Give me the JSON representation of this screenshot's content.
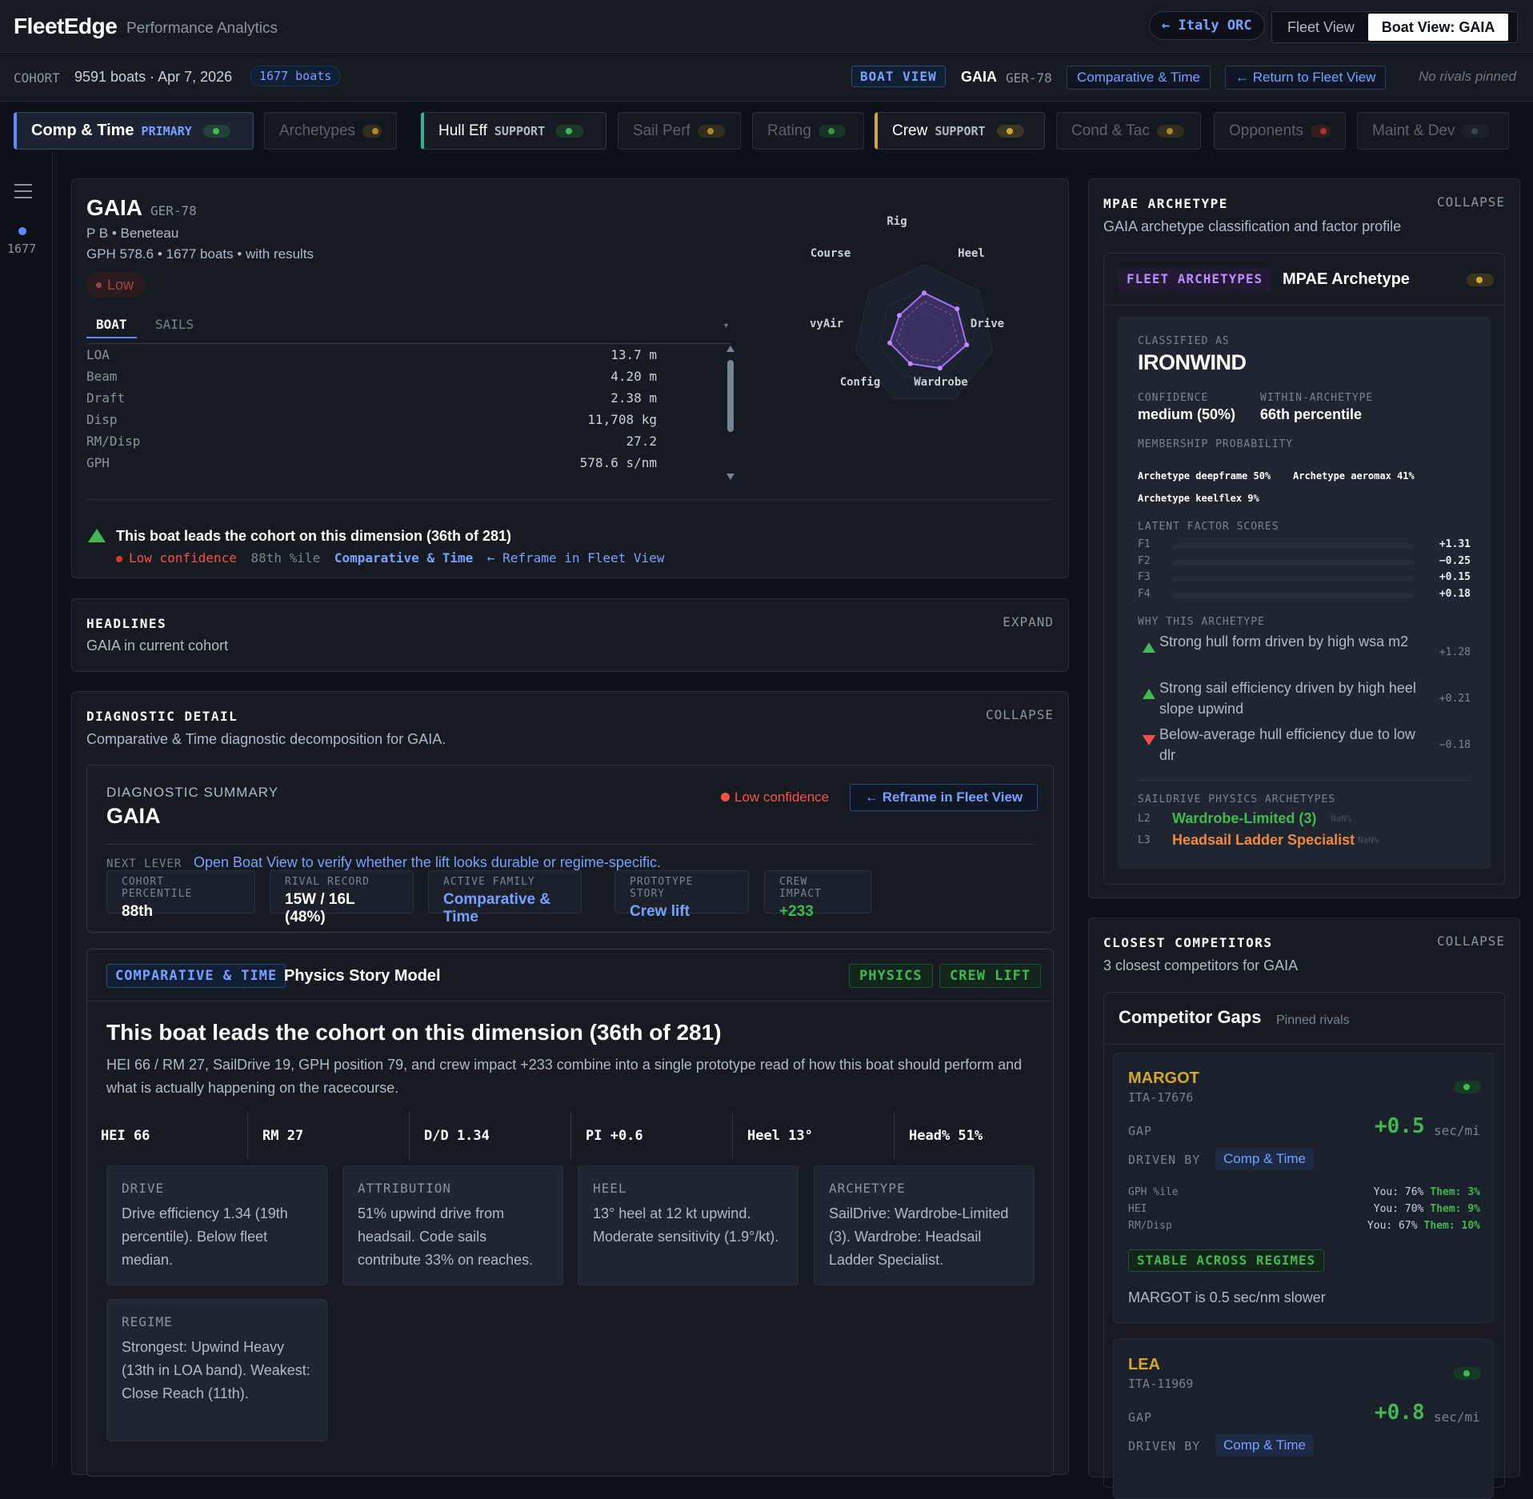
{
  "app": {
    "brand": "FleetEdge",
    "subtitle": "Performance Analytics",
    "orc_pill": "← Italy ORC",
    "views": [
      "Fleet View",
      "Boat View: GAIA"
    ]
  },
  "cohort": {
    "label": "COHORT",
    "summary": "9591 boats · Apr 7, 2026",
    "count_badge": "1677 boats",
    "boat_view_badge": "BOAT VIEW",
    "boat_name": "GAIA",
    "sail_no": "GER-78",
    "comparative_btn": "Comparative & Time",
    "return_btn": "← Return to Fleet View",
    "rivals": "No rivals pinned"
  },
  "tabs": [
    {
      "label": "Comp & Time",
      "kind": "PRIMARY",
      "accent": "#5b8cff",
      "dot": "#3fb950"
    },
    {
      "label": "Archetypes",
      "kind": "",
      "accent": "",
      "dot": "#d4a72c"
    },
    {
      "label": "Hull Eff",
      "kind": "SUPPORT",
      "accent": "#2fb394",
      "dot": "#3fb950"
    },
    {
      "label": "Sail Perf",
      "kind": "",
      "accent": "",
      "dot": "#d4a72c"
    },
    {
      "label": "Rating",
      "kind": "",
      "accent": "",
      "dot": "#3fb950"
    },
    {
      "label": "Crew",
      "kind": "SUPPORT",
      "accent": "#d4a72c",
      "dot": "#d4a72c"
    },
    {
      "label": "Cond & Tac",
      "kind": "",
      "accent": "",
      "dot": "#d4a72c"
    },
    {
      "label": "Opponents",
      "kind": "",
      "accent": "",
      "dot": "#da3633"
    },
    {
      "label": "Maint & Dev",
      "kind": "",
      "accent": "",
      "dot": "#484f58"
    }
  ],
  "rail": {
    "count": "1677"
  },
  "boat": {
    "name": "GAIA",
    "sail_no": "GER-78",
    "model": "P B • Beneteau",
    "gph_line": "GPH 578.6 • 1677 boats • with results",
    "conf_badge": "Low",
    "tabs": [
      "BOAT",
      "SAILS"
    ],
    "specs": [
      {
        "k": "LOA",
        "v": "13.7 m"
      },
      {
        "k": "Beam",
        "v": "4.20 m"
      },
      {
        "k": "Draft",
        "v": "2.38 m"
      },
      {
        "k": "Disp",
        "v": "11,708 kg"
      },
      {
        "k": "RM/Disp",
        "v": "27.2"
      },
      {
        "k": "GPH",
        "v": "578.6 s/nm"
      }
    ],
    "radar_labels": [
      "Rig",
      "Heel",
      "Drive",
      "Wardrobe",
      "Config",
      "HvyAir",
      "Course"
    ],
    "radar_display_labels": [
      "Rig",
      "Heel",
      "Drive",
      "Wardrobe",
      "Config",
      "⁠vyAir",
      "Course"
    ],
    "radar_values": [
      0.6,
      0.6,
      0.62,
      0.52,
      0.45,
      0.5,
      0.45
    ],
    "headline": "This boat leads the cohort on this dimension (36th of 281)",
    "footer_conf": "Low confidence",
    "footer_pct": "88th %ile",
    "footer_link1": "Comparative & Time",
    "footer_link2": "← Reframe in Fleet View"
  },
  "headlines": {
    "title": "HEADLINES",
    "action": "EXPAND",
    "sub": "GAIA in current cohort"
  },
  "diag": {
    "title": "DIAGNOSTIC DETAIL",
    "action": "COLLAPSE",
    "sub": "Comparative & Time diagnostic decomposition for GAIA.",
    "summary_label": "DIAGNOSTIC SUMMARY",
    "summary_name": "GAIA",
    "conf": "Low confidence",
    "reframe_btn": "← Reframe in Fleet View",
    "next_label": "NEXT LEVER",
    "next_text": "Open Boat View to verify whether the lift looks durable or regime-specific.",
    "kv": [
      {
        "k": "COHORT PERCENTILE",
        "v": "88th"
      },
      {
        "k": "RIVAL RECORD",
        "v": "15W / 16L (48%)"
      },
      {
        "k": "ACTIVE FAMILY",
        "v": "Comparative & Time"
      },
      {
        "k": "PROTOTYPE STORY",
        "v": "Crew lift"
      },
      {
        "k": "CREW IMPACT",
        "v": "+233"
      }
    ],
    "story_badge": "COMPARATIVE & TIME",
    "story_title": "Physics Story Model",
    "story_tags": [
      "PHYSICS",
      "CREW LIFT"
    ],
    "story_headline": "This boat leads the cohort on this dimension (36th of 281)",
    "story_text": "HEI 66 / RM 27, SailDrive 19, GPH position 79, and crew impact +233 combine into a single prototype read of how this boat should perform and what is actually happening on the racecourse.",
    "stats": [
      "HEI 66",
      "RM 27",
      "D/D 1.34",
      "PI +0.6",
      "Heel 13°",
      "Head% 51%"
    ],
    "tiles": [
      {
        "k": "DRIVE",
        "t": "Drive efficiency 1.34 (19th percentile). Below fleet median."
      },
      {
        "k": "ATTRIBUTION",
        "t": "51% upwind drive from headsail. Code sails contribute 33% on reaches."
      },
      {
        "k": "HEEL",
        "t": "13° heel at 12 kt upwind. Moderate sensitivity (1.9°/kt)."
      },
      {
        "k": "ARCHETYPE",
        "t": "SailDrive: Wardrobe-Limited (3). Wardrobe: Headsail Ladder Specialist."
      },
      {
        "k": "REGIME",
        "t": "Strongest: Upwind Heavy (13th in LOA band). Weakest: Close Reach (11th)."
      }
    ]
  },
  "mpae": {
    "title": "MPAE ARCHETYPE",
    "action": "COLLAPSE",
    "sub": "GAIA archetype classification and factor profile",
    "tag": "FLEET ARCHETYPES",
    "heading": "MPAE Archetype",
    "classified_label": "CLASSIFIED AS",
    "classified": "IRONWIND",
    "conf_label": "CONFIDENCE",
    "conf": "medium (50%)",
    "within_label": "WITHIN-ARCHETYPE",
    "within": "66th percentile",
    "membership_label": "MEMBERSHIP PROBABILITY",
    "membership": [
      "Archetype deepframe 50%",
      "Archetype aeromax 41%",
      "Archetype keelflex 9%"
    ],
    "latent_label": "LATENT FACTOR SCORES",
    "factors": [
      {
        "k": "F1",
        "v": "+1.31"
      },
      {
        "k": "F2",
        "v": "−0.25"
      },
      {
        "k": "F3",
        "v": "+0.15"
      },
      {
        "k": "F4",
        "v": "+0.18"
      }
    ],
    "why_label": "WHY THIS ARCHETYPE",
    "why": [
      {
        "t": "Strong hull form driven by high wsa m2",
        "s": "+1.28",
        "dir": "up"
      },
      {
        "t": "Strong sail efficiency driven by high heel slope upwind",
        "s": "+0.21",
        "dir": "up"
      },
      {
        "t": "Below-average hull efficiency due to low dlr",
        "s": "−0.18",
        "dir": "down"
      }
    ],
    "saildrive_label": "SAILDRIVE PHYSICS ARCHETYPES",
    "saildrive": [
      {
        "k": "L2",
        "v": "Wardrobe-Limited (3)",
        "n": "NaN%",
        "c": "#3fb950"
      },
      {
        "k": "L3",
        "v": "Headsail Ladder Specialist",
        "n": "NaN%",
        "c": "#f0883e"
      }
    ]
  },
  "competitors": {
    "title": "CLOSEST COMPETITORS",
    "action": "COLLAPSE",
    "sub": "3 closest competitors for GAIA",
    "heading": "Competitor Gaps",
    "pinned": "Pinned rivals",
    "items": [
      {
        "name": "MARGOT",
        "sail": "ITA-17676",
        "gap_label": "GAP",
        "gap": "+0.5",
        "unit": "sec/mi",
        "driven_label": "DRIVEN BY",
        "driven": "Comp & Time",
        "rows": [
          {
            "k": "GPH %ile",
            "you": "You: 76%",
            "them": "Them: 3%"
          },
          {
            "k": "HEI",
            "you": "You: 70%",
            "them": "Them: 9%"
          },
          {
            "k": "RM/Disp",
            "you": "You: 67%",
            "them": "Them: 10%"
          }
        ],
        "stable": "STABLE ACROSS REGIMES",
        "note": "MARGOT is 0.5 sec/nm slower"
      },
      {
        "name": "LEA",
        "sail": "ITA-11969",
        "gap_label": "GAP",
        "gap": "+0.8",
        "unit": "sec/mi",
        "driven_label": "DRIVEN BY",
        "driven": "Comp & Time"
      }
    ]
  }
}
